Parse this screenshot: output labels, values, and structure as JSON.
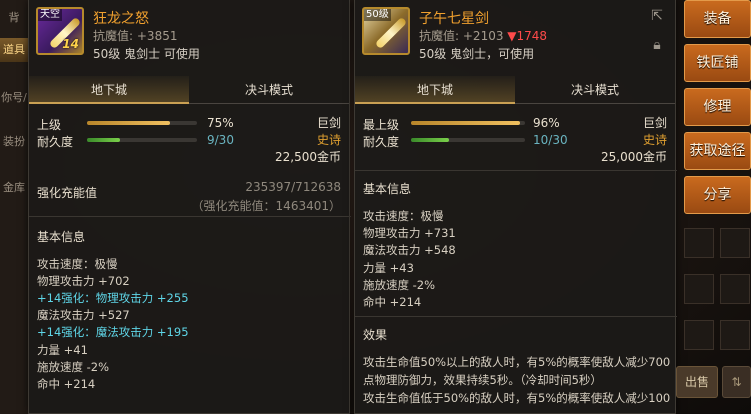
{
  "left_strip": {
    "tab_top": "背",
    "tab_active": "道具",
    "tab_account": "你号/",
    "tab_outfit": "装扮",
    "tab_vault": "金库"
  },
  "left_item": {
    "icon_tag": "天空",
    "plus": "14",
    "name": "狂龙之怒",
    "resist_label": "抗魔值:",
    "resist_value": "+3851",
    "usable": "50级 鬼剑士 可使用",
    "tabs": [
      "地下城",
      "决斗模式"
    ],
    "grade_label": "上级",
    "grade_pct": "75%",
    "grade_fill": 0.75,
    "dur_label": "耐久度",
    "dur_value": "9/30",
    "dur_fill": 0.3,
    "type": "巨剑",
    "rarity": "史诗",
    "price": "22,500金币",
    "enhance_label": "强化充能值",
    "enhance_value": "235397/712638",
    "enhance_sub": "（强化充能值：1463401）",
    "basic_title": "基本信息",
    "lines": [
      {
        "text": "攻击速度：极慢",
        "cyan": false
      },
      {
        "text": "物理攻击力 +702",
        "cyan": false
      },
      {
        "text": "+14强化：物理攻击力 +255",
        "cyan": true
      },
      {
        "text": "魔法攻击力 +527",
        "cyan": false
      },
      {
        "text": "+14强化：魔法攻击力 +195",
        "cyan": true
      },
      {
        "text": "力量 +41",
        "cyan": false
      },
      {
        "text": "施放速度 -2%",
        "cyan": false
      },
      {
        "text": "命中 +214",
        "cyan": false
      }
    ]
  },
  "right_item": {
    "icon_tag": "50级",
    "name": "子午七星剑",
    "resist_label": "抗魔值:",
    "resist_value": "+2103",
    "resist_delta": "▼1748",
    "usable": "50级 鬼剑士，可使用",
    "tabs": [
      "地下城",
      "决斗模式"
    ],
    "grade_label": "最上级",
    "grade_pct": "96%",
    "grade_fill": 0.96,
    "dur_label": "耐久度",
    "dur_value": "10/30",
    "dur_fill": 0.33,
    "type": "巨剑",
    "rarity": "史诗",
    "price": "25,000金币",
    "basic_title": "基本信息",
    "lines": [
      "攻击速度：极慢",
      "物理攻击力 +731",
      "魔法攻击力 +548",
      "力量 +43",
      "施放速度 -2%",
      "命中 +214"
    ],
    "effect_title": "效果",
    "effect_lines": [
      "攻击生命值50%以上的敌人时，有5%的概率使敌人减少700",
      "点物理防御力，效果持续5秒。（冷却时间5秒）",
      "攻击生命值低于50%的敌人时，有5%的概率使敌人减少100"
    ]
  },
  "side_buttons": [
    "装备",
    "铁匠铺",
    "修理",
    "获取途径",
    "分享"
  ],
  "bottom": {
    "sell": "出售"
  }
}
